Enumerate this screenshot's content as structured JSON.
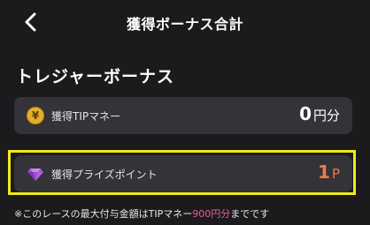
{
  "header": {
    "title": "獲得ボーナス合計"
  },
  "section": {
    "title": "トレジャーボーナス"
  },
  "tip_card": {
    "icon": "yen-coin-icon",
    "icon_glyph": "¥",
    "label": "獲得TIPマネー",
    "value": "0",
    "unit": "円分"
  },
  "prize_card": {
    "icon": "gem-icon",
    "label": "獲得プライズポイント",
    "value": "1",
    "unit": "P",
    "highlight_color": "#f2ea1c"
  },
  "note": {
    "prefix": "※このレースの最大付与金額はTIPマネー",
    "amount": "900円分",
    "suffix": "までです"
  },
  "colors": {
    "background": "#1b1b1d",
    "card": "#333338",
    "accent_orange": "#f27a4c",
    "accent_pink": "#ef5aa7",
    "highlight_yellow": "#f2ea1c"
  }
}
